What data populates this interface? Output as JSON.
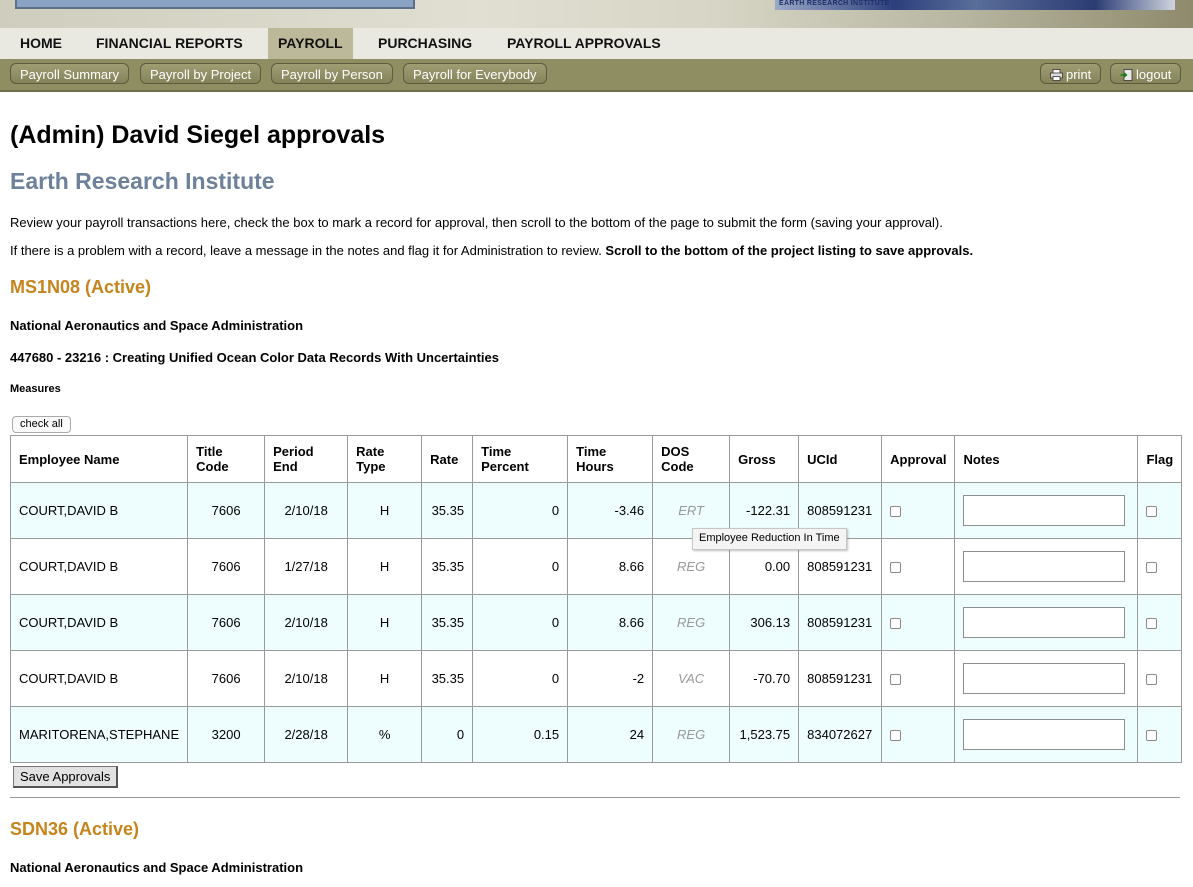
{
  "banner": {
    "logo_text": "EARTH RESEARCH INSTITUTE"
  },
  "mainnav": [
    "HOME",
    "FINANCIAL REPORTS",
    "PAYROLL",
    "PURCHASING",
    "PAYROLL APPROVALS"
  ],
  "mainnav_active": "PAYROLL",
  "subnav": [
    "Payroll Summary",
    "Payroll by Project",
    "Payroll by Person",
    "Payroll for Everybody"
  ],
  "actions": {
    "print": "print",
    "logout": "logout"
  },
  "page": {
    "title": "(Admin) David Siegel approvals",
    "institute": "Earth Research Institute",
    "intro1": "Review your payroll transactions here, check the box to mark a record for approval, then scroll to the bottom of the page to submit the form (saving your approval).",
    "intro2_plain": "If there is a problem with a record, leave a message in the notes and flag it for Administration to review. ",
    "intro2_bold": "Scroll to the bottom of the project listing to save approvals."
  },
  "project1": {
    "heading": "MS1N08 (Active)",
    "sponsor": "National Aeronautics and Space Administration",
    "award": "447680 - 23216 : Creating Unified Ocean Color Data Records With Uncertainties",
    "subtitle": "Measures",
    "check_all": "check all",
    "columns": [
      "Employee Name",
      "Title Code",
      "Period End",
      "Rate Type",
      "Rate",
      "Time Percent",
      "Time Hours",
      "DOS Code",
      "Gross",
      "UCId",
      "Approval",
      "Notes",
      "Flag"
    ],
    "rows": [
      {
        "name": "COURT,DAVID B",
        "title": "7606",
        "period": "2/10/18",
        "rate_type": "H",
        "rate": "35.35",
        "time_pct": "0",
        "hours": "-3.46",
        "dos": "ERT",
        "gross": "-122.31",
        "ucid": "808591231"
      },
      {
        "name": "COURT,DAVID B",
        "title": "7606",
        "period": "1/27/18",
        "rate_type": "H",
        "rate": "35.35",
        "time_pct": "0",
        "hours": "8.66",
        "dos": "REG",
        "gross": "0.00",
        "ucid": "808591231"
      },
      {
        "name": "COURT,DAVID B",
        "title": "7606",
        "period": "2/10/18",
        "rate_type": "H",
        "rate": "35.35",
        "time_pct": "0",
        "hours": "8.66",
        "dos": "REG",
        "gross": "306.13",
        "ucid": "808591231"
      },
      {
        "name": "COURT,DAVID B",
        "title": "7606",
        "period": "2/10/18",
        "rate_type": "H",
        "rate": "35.35",
        "time_pct": "0",
        "hours": "-2",
        "dos": "VAC",
        "gross": "-70.70",
        "ucid": "808591231"
      },
      {
        "name": "MARITORENA,STEPHANE",
        "title": "3200",
        "period": "2/28/18",
        "rate_type": "%",
        "rate": "0",
        "time_pct": "0.15",
        "hours": "24",
        "dos": "REG",
        "gross": "1,523.75",
        "ucid": "834072627"
      }
    ],
    "tooltip": "Employee Reduction In Time",
    "save_label": "Save Approvals"
  },
  "project2": {
    "heading": "SDN36 (Active)",
    "sponsor": "National Aeronautics and Space Administration"
  },
  "colors": {
    "accent": "#c5841c",
    "institute": "#6d819a",
    "subnav": "#8f8e62",
    "row_alt": "#eefefe"
  }
}
